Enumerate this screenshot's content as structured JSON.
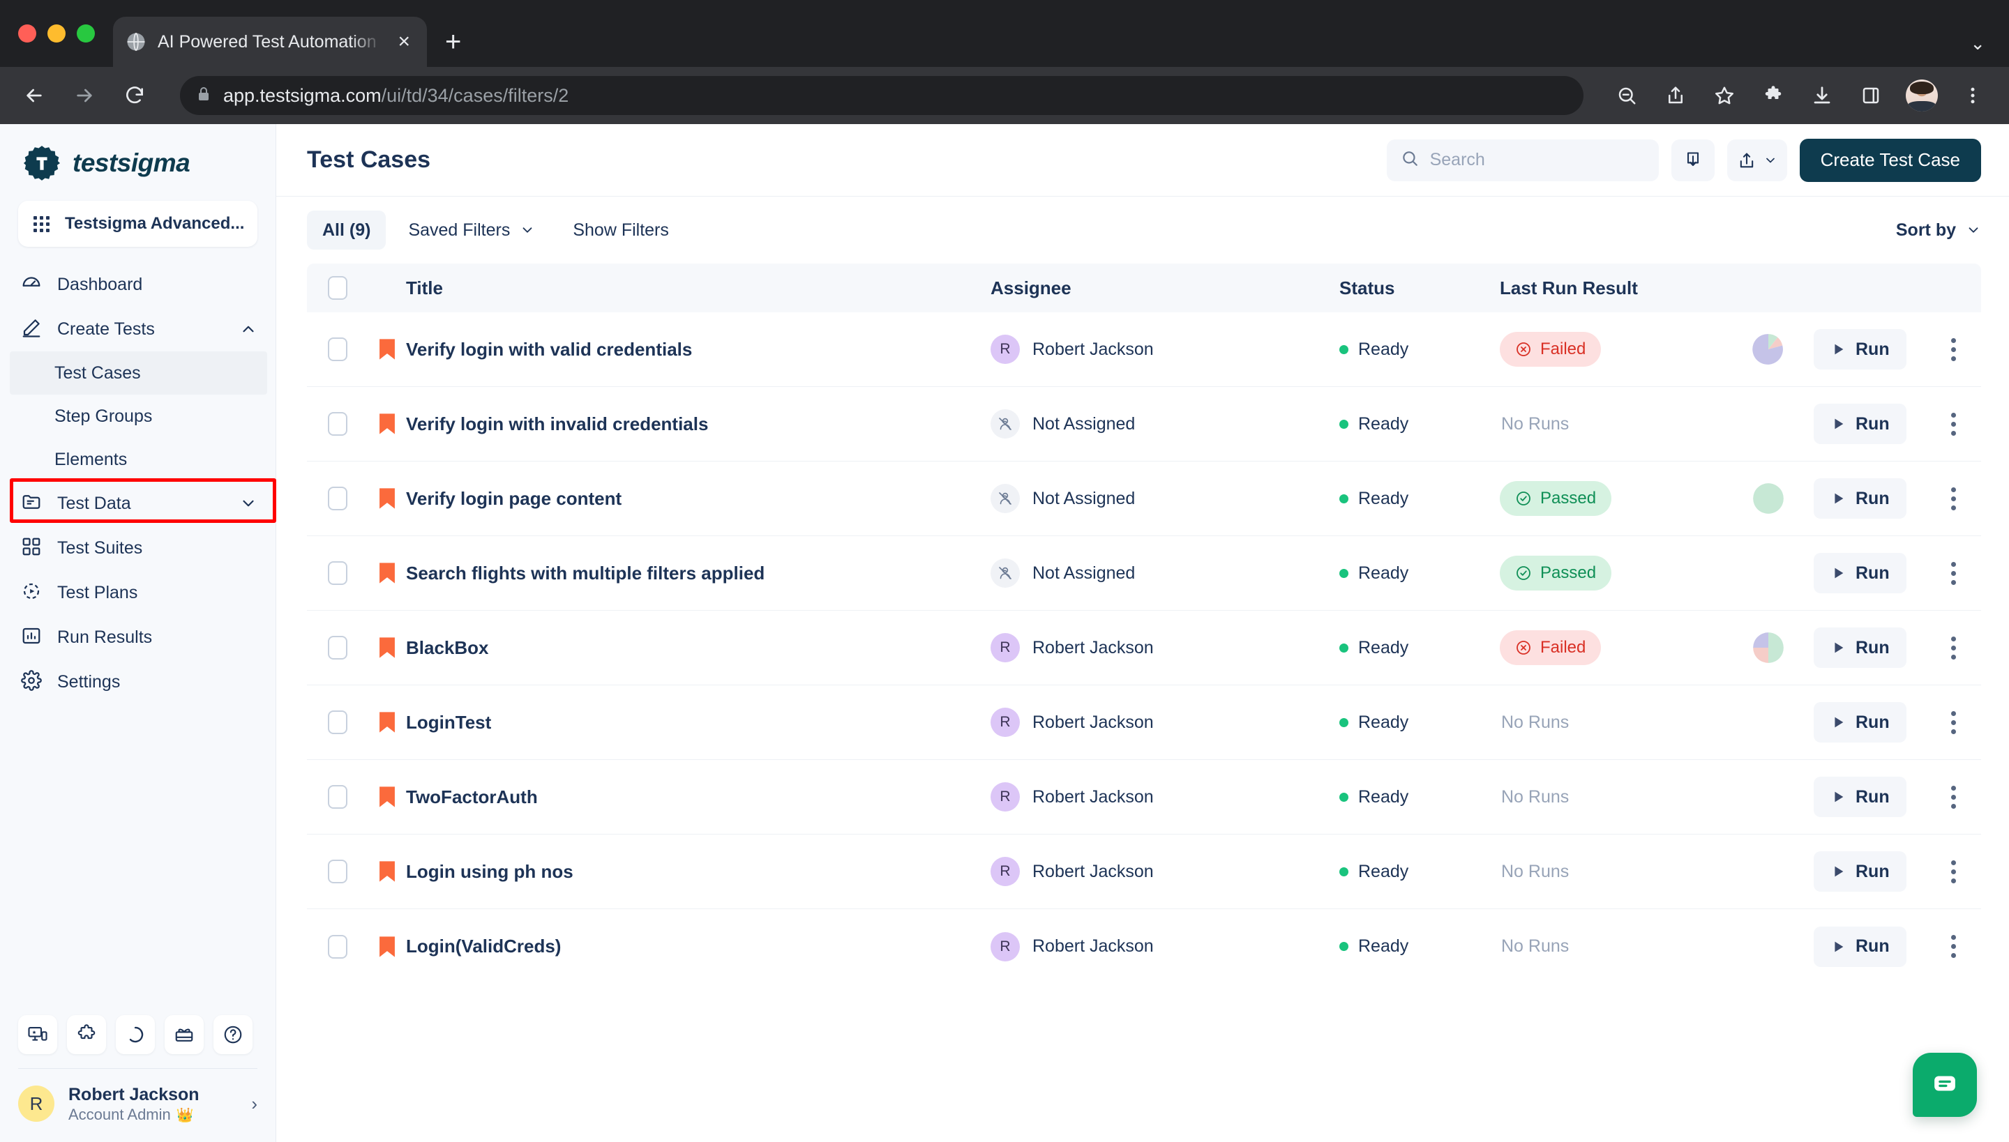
{
  "browser": {
    "tab": {
      "title": "AI Powered Test Automation Pl",
      "favicon": "globe-icon",
      "close": "×"
    },
    "new_tab": "+",
    "tabstrip_chevron": "⌄",
    "url_host": "app.testsigma.com",
    "url_path": "/ui/td/34/cases/filters/2",
    "toolbar_icons": [
      "zoom-out-icon",
      "share-icon",
      "bookmark-star-icon",
      "extensions-icon",
      "downloads-icon",
      "side-panel-icon",
      "profile-avatar",
      "chrome-menu-icon"
    ]
  },
  "sidebar": {
    "logo_text": "testsigma",
    "project": {
      "label": "Testsigma Advanced...",
      "icon": "apps-grid-icon"
    },
    "nav": [
      {
        "label": "Dashboard",
        "icon": "dashboard-icon",
        "type": "item"
      },
      {
        "label": "Create Tests",
        "icon": "pencil-icon",
        "type": "item",
        "chevron": "up"
      },
      {
        "label": "Test Cases",
        "type": "sub",
        "active": true
      },
      {
        "label": "Step Groups",
        "type": "sub",
        "active": false
      },
      {
        "label": "Elements",
        "type": "sub",
        "active": false
      },
      {
        "label": "Test Data",
        "icon": "folder-icon",
        "type": "item",
        "chevron": "down"
      },
      {
        "label": "Test Suites",
        "icon": "grid-icon",
        "type": "item"
      },
      {
        "label": "Test Plans",
        "icon": "play-circle-icon",
        "type": "item"
      },
      {
        "label": "Run Results",
        "icon": "bar-chart-icon",
        "type": "item"
      },
      {
        "label": "Settings",
        "icon": "gear-icon",
        "type": "item"
      }
    ],
    "tools": [
      "devices-icon",
      "puzzle-icon",
      "progress-circle-icon",
      "gift-icon",
      "help-icon"
    ],
    "user": {
      "initial": "R",
      "name": "Robert Jackson",
      "role": "Account Admin",
      "crown": "👑",
      "chevron": "›"
    }
  },
  "header": {
    "title": "Test Cases",
    "search": {
      "placeholder": "Search",
      "value": "",
      "icon": "search-icon"
    },
    "import_button": "import-icon",
    "export_button": "export-icon",
    "export_chevron": "⌄",
    "create_button": "Create Test Case"
  },
  "filters": {
    "all_tab": "All (9)",
    "saved_filters": "Saved Filters",
    "saved_filters_chevron": "⌄",
    "show_filters": "Show Filters",
    "sort_by": "Sort by",
    "sort_chevron": "⌄"
  },
  "table": {
    "columns": [
      "Title",
      "Assignee",
      "Status",
      "Last Run Result"
    ],
    "rows": [
      {
        "title": "Verify login with valid credentials",
        "assignee": "Robert Jackson",
        "assignee_initial": "R",
        "assigned": true,
        "status": "Ready",
        "result": "Failed",
        "pie": "mixed-purple",
        "run": "Run"
      },
      {
        "title": "Verify login with invalid credentials",
        "assignee": "Not Assigned",
        "assignee_initial": "",
        "assigned": false,
        "status": "Ready",
        "result": "No Runs",
        "pie": "none",
        "run": "Run"
      },
      {
        "title": "Verify login page content",
        "assignee": "Not Assigned",
        "assignee_initial": "",
        "assigned": false,
        "status": "Ready",
        "result": "Passed",
        "pie": "all-green",
        "run": "Run"
      },
      {
        "title": "Search flights with multiple filters applied",
        "assignee": "Not Assigned",
        "assignee_initial": "",
        "assigned": false,
        "status": "Ready",
        "result": "Passed",
        "pie": "none",
        "run": "Run"
      },
      {
        "title": "BlackBox",
        "assignee": "Robert Jackson",
        "assignee_initial": "R",
        "assigned": true,
        "status": "Ready",
        "result": "Failed",
        "pie": "quarters",
        "run": "Run"
      },
      {
        "title": "LoginTest",
        "assignee": "Robert Jackson",
        "assignee_initial": "R",
        "assigned": true,
        "status": "Ready",
        "result": "No Runs",
        "pie": "none",
        "run": "Run"
      },
      {
        "title": "TwoFactorAuth",
        "assignee": "Robert Jackson",
        "assignee_initial": "R",
        "assigned": true,
        "status": "Ready",
        "result": "No Runs",
        "pie": "none",
        "run": "Run"
      },
      {
        "title": "Login using ph nos",
        "assignee": "Robert Jackson",
        "assignee_initial": "R",
        "assigned": true,
        "status": "Ready",
        "result": "No Runs",
        "pie": "none",
        "run": "Run"
      },
      {
        "title": "Login(ValidCreds)",
        "assignee": "Robert Jackson",
        "assignee_initial": "R",
        "assigned": true,
        "status": "Ready",
        "result": "No Runs",
        "pie": "none",
        "run": "Run"
      }
    ]
  },
  "chat": {
    "icon": "chat-bubble-icon"
  },
  "colors": {
    "brand_dark": "#0e3b4e",
    "accent_green": "#19c37d",
    "failed_bg": "#fde0e0",
    "failed_fg": "#d93025",
    "passed_bg": "#d6f2e1",
    "passed_fg": "#0f8f56",
    "priority_flag": "#fb6a3c",
    "highlight_box": "#ff0000",
    "chat_fab": "#0bab6c"
  }
}
